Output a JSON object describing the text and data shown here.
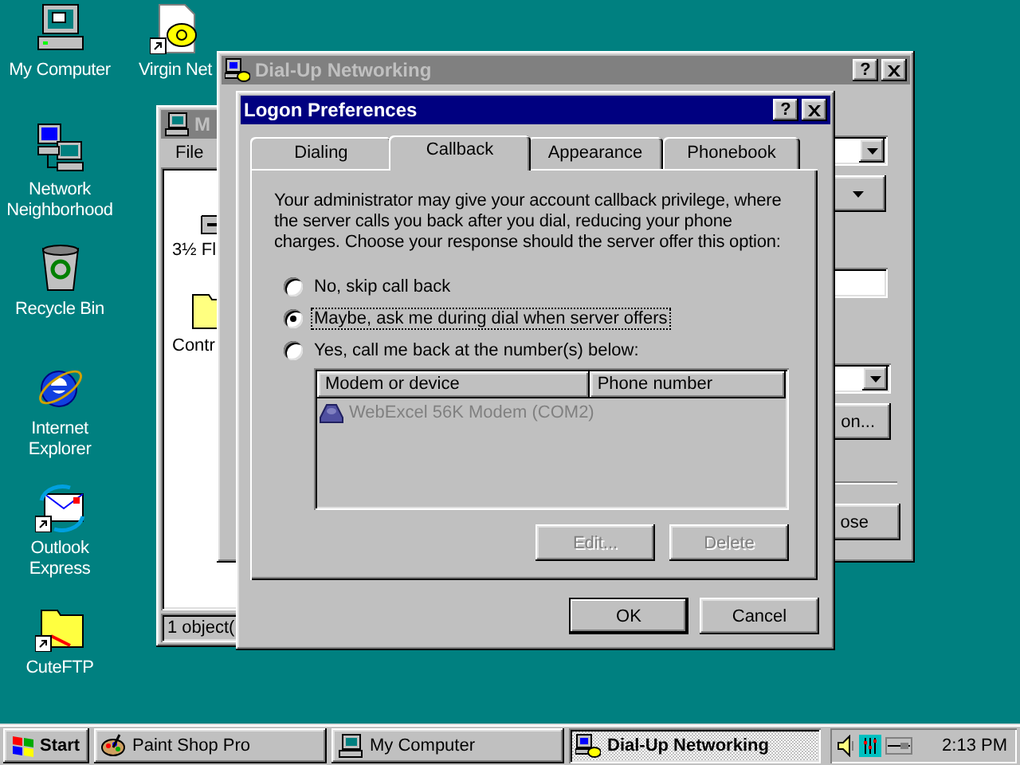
{
  "desktop_icons": [
    {
      "label": "My Computer",
      "kind": "computer"
    },
    {
      "label": "Network Neighborhood",
      "kind": "network"
    },
    {
      "label": "Recycle Bin",
      "kind": "bin"
    },
    {
      "label": "Internet Explorer",
      "kind": "browser"
    },
    {
      "label": "Outlook Express",
      "kind": "mail"
    },
    {
      "label": "CuteFTP",
      "kind": "ftp"
    },
    {
      "label": "Virgin Net",
      "kind": "phone"
    }
  ],
  "my_computer_window": {
    "title": "M",
    "active": false,
    "menu": [
      "File"
    ],
    "items": [
      {
        "label": "3½ Fl",
        "kind": "floppy"
      },
      {
        "label": "Contr",
        "kind": "folder"
      }
    ],
    "status": "1 object("
  },
  "dialup_window": {
    "title": "Dial-Up Networking",
    "active": false,
    "help": "?",
    "buttons": [
      {
        "label": "on..."
      },
      {
        "label": "ose"
      }
    ]
  },
  "dialog": {
    "title": "Logon Preferences",
    "active": true,
    "help": "?",
    "tabs": [
      {
        "label": "Dialing",
        "selected": false
      },
      {
        "label": "Callback",
        "selected": true
      },
      {
        "label": "Appearance",
        "selected": false
      },
      {
        "label": "Phonebook",
        "selected": false
      }
    ],
    "description": "Your administrator may give your account callback privilege, where the server calls you back after you dial, reducing your phone charges.  Choose your response should the server offer this option:",
    "options": [
      {
        "label": "No, skip call back",
        "selected": false
      },
      {
        "label": "Maybe, ask me during dial when server offers",
        "selected": true
      },
      {
        "label": "Yes, call me back at the number(s) below:",
        "selected": false
      }
    ],
    "list": {
      "disabled": true,
      "columns": [
        "Modem or device",
        "Phone number"
      ],
      "rows": [
        {
          "device": "WebExcel 56K Modem (COM2)"
        }
      ]
    },
    "list_buttons": [
      {
        "label": "Edit...",
        "disabled": true
      },
      {
        "label": "Delete",
        "disabled": true
      }
    ],
    "buttons": [
      {
        "label": "OK",
        "default": true
      },
      {
        "label": "Cancel",
        "default": false
      }
    ]
  },
  "taskbar": {
    "start": "Start",
    "tasks": [
      {
        "label": "Paint Shop Pro",
        "kind": "paint",
        "selected": false
      },
      {
        "label": "My Computer",
        "kind": "computer",
        "selected": false
      },
      {
        "label": "Dial-Up Networking",
        "kind": "dialup",
        "selected": true
      }
    ],
    "clock": "2:13 PM"
  }
}
